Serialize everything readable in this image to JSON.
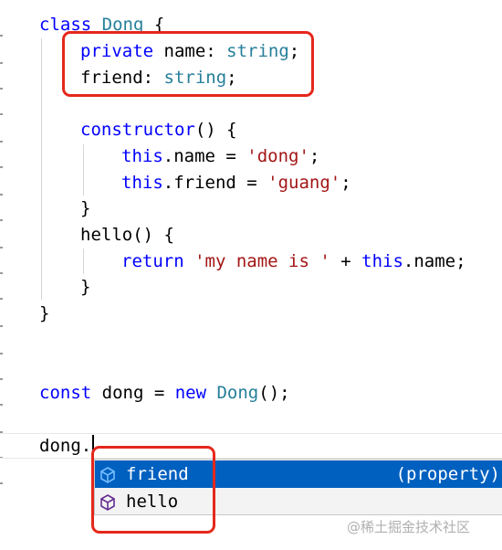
{
  "editor": {
    "lines": {
      "class_decl": {
        "kw": "class ",
        "name": "Dong",
        "rest": " {"
      },
      "prop_name": {
        "kw": "private ",
        "ident": "name: ",
        "type": "string",
        "end": ";"
      },
      "prop_friend": {
        "ident": "friend: ",
        "type": "string",
        "end": ";"
      },
      "ctor": {
        "kw": "constructor",
        "rest": "() {"
      },
      "assign_name": {
        "kw": "this",
        "mid": ".name = ",
        "str": "'dong'",
        "end": ";"
      },
      "assign_friend": {
        "kw": "this",
        "mid": ".friend = ",
        "str": "'guang'",
        "end": ";"
      },
      "ctor_close": {
        "text": "}"
      },
      "hello_decl": {
        "text": "hello() {"
      },
      "return_stmt": {
        "kw": "return ",
        "str": "'my name is '",
        "mid": " + ",
        "kw2": "this",
        "end": ".name;"
      },
      "hello_close": {
        "text": "}"
      },
      "class_close": {
        "text": "}"
      },
      "const_decl": {
        "kw": "const ",
        "mid": "dong = ",
        "kw2": "new ",
        "cls": "Dong",
        "end": "();"
      },
      "member_access": {
        "text": "dong."
      }
    }
  },
  "suggest": {
    "items": [
      {
        "label": "friend",
        "detail": "(property)",
        "icon": "property-cube-icon"
      },
      {
        "label": "hello",
        "detail": "",
        "icon": "method-cube-icon"
      }
    ]
  },
  "watermark": {
    "text": "@稀土掘金技术社区"
  },
  "colors": {
    "keyword": "#0000ff",
    "type": "#267f99",
    "string": "#a31515",
    "highlight": "#e5281c",
    "selected": "#0060c0"
  }
}
